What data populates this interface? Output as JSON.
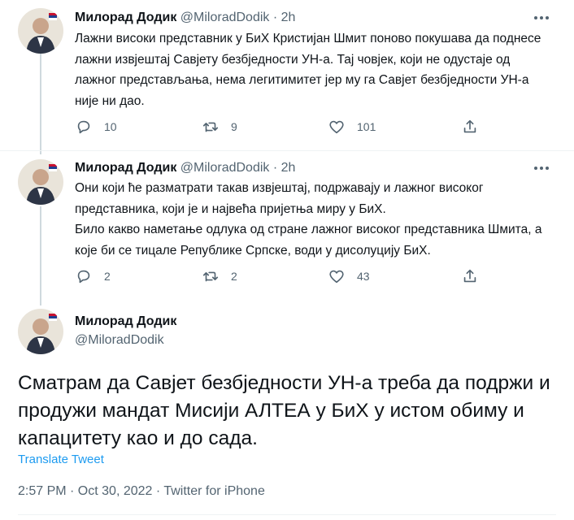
{
  "tweets": [
    {
      "name": "Милорад Додик",
      "handle": "@MiloradDodik",
      "separator": "·",
      "time": "2h",
      "text": "Лажни високи представник у БиХ Кристијан Шмит поново покушава да поднесе лажни извјештај Савјету безбједности УН-а. Тај човјек, који не одустаје од лажног представљања, нема легитимитет јер му га Савјет безбједности УН-а није ни дао.",
      "replies": "10",
      "retweets": "9",
      "likes": "101"
    },
    {
      "name": "Милорад Додик",
      "handle": "@MiloradDodik",
      "separator": "·",
      "time": "2h",
      "text": "Они који ће разматрати такав извјештај, подржавају и лажног високог представника, који је и највећа пријетња миру у БиХ.\nБило какво наметање одлука од стране лажног високог представника Шмита, а које би се тицале  Републике Српске, води у дисолуцију БиХ.",
      "replies": "2",
      "retweets": "2",
      "likes": "43"
    }
  ],
  "main": {
    "name": "Милорад Додик",
    "handle": "@MiloradDodik",
    "text": "Сматрам да Савјет безбједности УН-а треба да подржи и продужи мандат Мисији АЛТЕА у БиХ у истом обиму и капацитету као и до сада.",
    "translate": "Translate Tweet",
    "meta": "2:57 PM · Oct 30, 2022 · Twitter for iPhone"
  },
  "colors": {
    "text": "#0f1419",
    "secondary": "#536471",
    "link": "#1d9bf0",
    "thread_line": "#cfd9de",
    "retweet_icon": "#536471"
  },
  "icons": [
    "reply-icon",
    "retweet-icon",
    "like-icon",
    "share-icon",
    "more-icon",
    "avatar"
  ]
}
